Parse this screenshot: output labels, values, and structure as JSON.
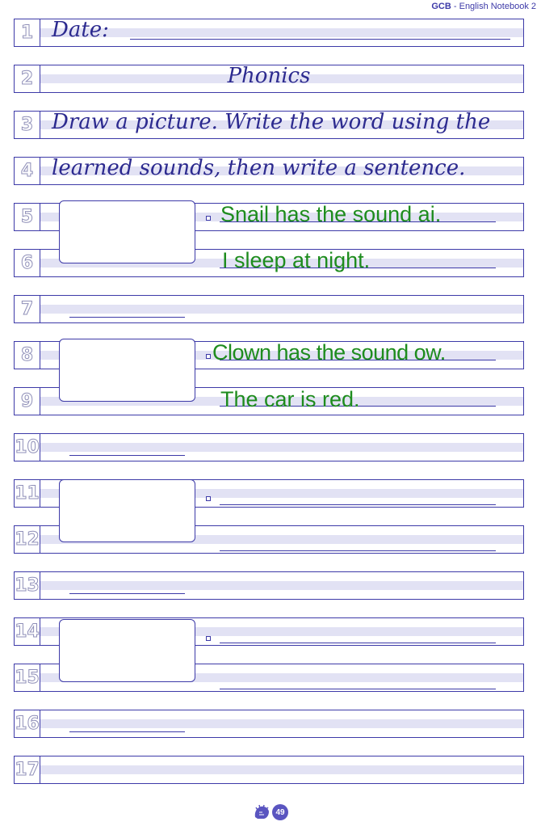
{
  "header": {
    "brand": "GCB",
    "subtitle": " - English Notebook 2"
  },
  "rows": [
    "1",
    "2",
    "3",
    "4",
    "5",
    "6",
    "7",
    "8",
    "9",
    "10",
    "11",
    "12",
    "13",
    "14",
    "15",
    "16",
    "17"
  ],
  "text": {
    "date_label": "Date:",
    "title": "Phonics",
    "instruction1": "Draw a picture. Write the word using the",
    "instruction2": "learned sounds, then write a sentence."
  },
  "answers": {
    "a1": "Snail has the sound ai.",
    "a2": "I sleep at night.",
    "a3": "Clown has the sound ow.",
    "a4": "The car is red."
  },
  "footer": {
    "page_number": "49"
  },
  "colors": {
    "ink": "#3d3aa8",
    "band": "#e2e2f4",
    "answer": "#1e8c1e"
  }
}
